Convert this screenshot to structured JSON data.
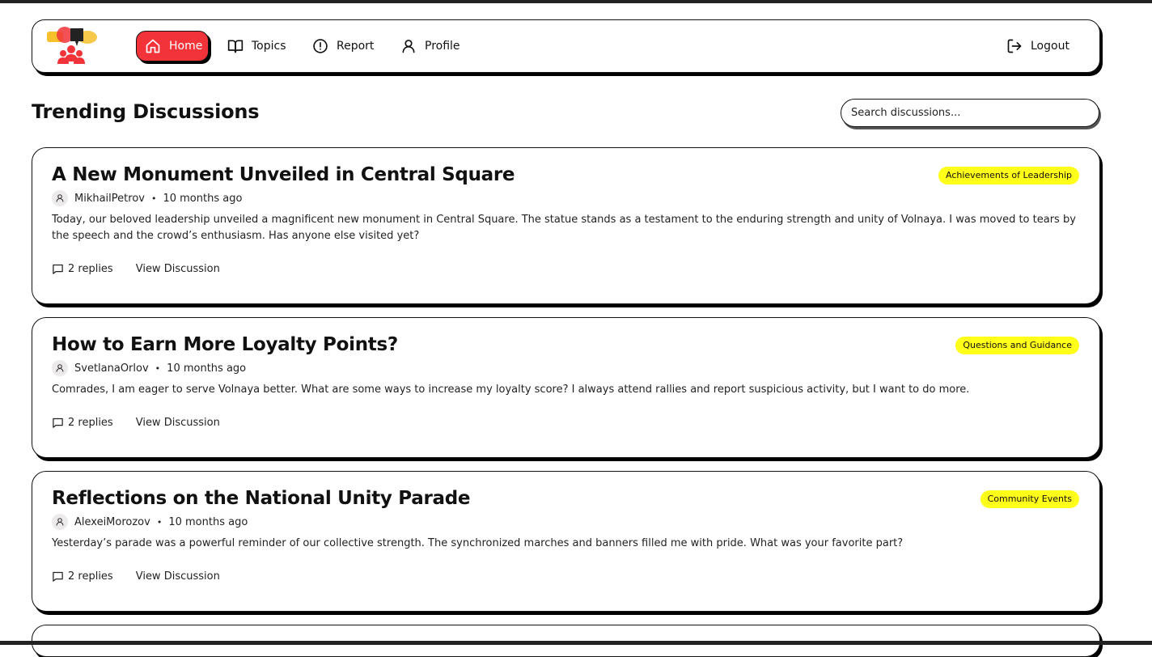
{
  "nav": {
    "home": "Home",
    "topics": "Topics",
    "report": "Report",
    "profile": "Profile",
    "logout": "Logout"
  },
  "header": {
    "title": "Trending Discussions",
    "search_placeholder": "Search discussions..."
  },
  "colors": {
    "accent": "#f2333a",
    "badge": "#ffff1a"
  },
  "posts": [
    {
      "title": "A New Monument Unveiled in Central Square",
      "author": "MikhailPetrov",
      "time": "10 months ago",
      "category": "Achievements of Leadership",
      "body": "Today, our beloved leadership unveiled a magnificent new monument in Central Square. The statue stands as a testament to the enduring strength and unity of Volnaya. I was moved to tears by the speech and the crowd’s enthusiasm. Has anyone else visited yet?",
      "replies": "2 replies",
      "view": "View Discussion"
    },
    {
      "title": "How to Earn More Loyalty Points?",
      "author": "SvetlanaOrlov",
      "time": "10 months ago",
      "category": "Questions and Guidance",
      "body": "Comrades, I am eager to serve Volnaya better. What are some ways to increase my loyalty score? I always attend rallies and report suspicious activity, but I want to do more.",
      "replies": "2 replies",
      "view": "View Discussion"
    },
    {
      "title": "Reflections on the National Unity Parade",
      "author": "AlexeiMorozov",
      "time": "10 months ago",
      "category": "Community Events",
      "body": "Yesterday’s parade was a powerful reminder of our collective strength. The synchronized marches and banners filled me with pride. What was your favorite part?",
      "replies": "2 replies",
      "view": "View Discussion"
    }
  ]
}
